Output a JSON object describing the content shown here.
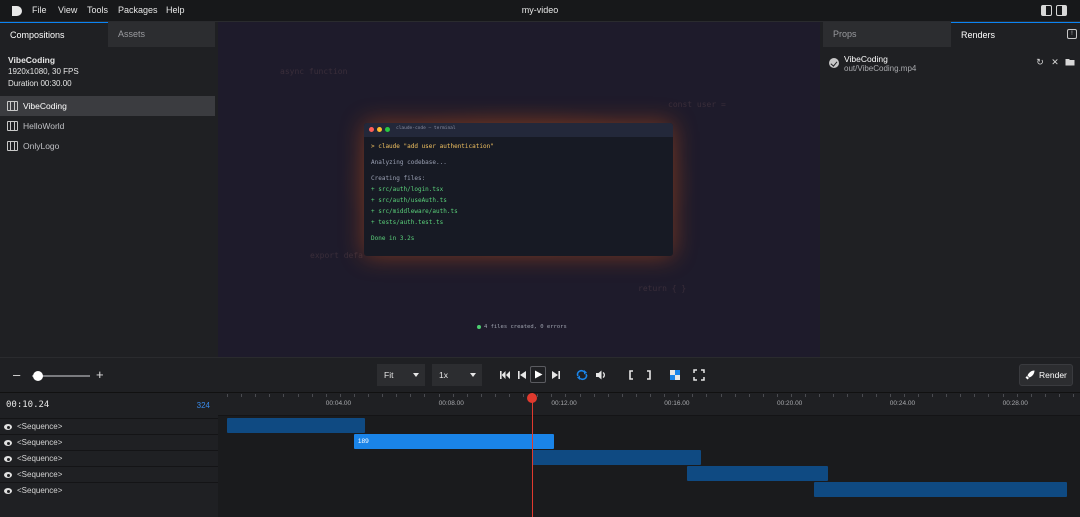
{
  "menubar": {
    "items": [
      "File",
      "View",
      "Tools",
      "Packages",
      "Help"
    ],
    "title": "my-video"
  },
  "left_panel": {
    "tabs": [
      "Compositions",
      "Assets"
    ],
    "selected_comp": {
      "name": "VibeCoding",
      "resolution": "1920x1080, 30 FPS",
      "duration": "Duration 00:30.00"
    },
    "compositions": [
      "VibeCoding",
      "HelloWorld",
      "OnlyLogo"
    ]
  },
  "preview": {
    "bg_code": [
      "async function",
      "const user =",
      "export defa",
      "return { }"
    ],
    "terminal": {
      "title": "claude-code — terminal",
      "command": "> claude \"add user authentication\"",
      "analyzing": "Analyzing codebase...",
      "creating": "Creating files:",
      "files": [
        "+ src/auth/login.tsx",
        "+ src/auth/useAuth.ts",
        "+ src/middleware/auth.ts",
        "+ tests/auth.test.ts"
      ],
      "done": "Done in 3.2s"
    },
    "status": "4 files created, 0 errors"
  },
  "right_panel": {
    "tabs": [
      "Props",
      "Renders"
    ],
    "info_badge": "!",
    "render": {
      "name": "VibeCoding",
      "path": "out/VibeCoding.mp4"
    }
  },
  "controls": {
    "zoom_level": 0.1,
    "fit_label": "Fit",
    "speed_label": "1x",
    "render_label": "Render"
  },
  "timeline": {
    "timecode": "00:10.24",
    "frame": "324",
    "ticks": [
      "00:04.00",
      "00:08.00",
      "00:12.00",
      "00:16.00",
      "00:20.00",
      "00:24.00",
      "00:28.00"
    ],
    "tracks": [
      {
        "label": "<Sequence>",
        "start_s": 0.0,
        "end_s": 4.9,
        "badge": ""
      },
      {
        "label": "<Sequence>",
        "start_s": 4.5,
        "end_s": 11.6,
        "badge": "189"
      },
      {
        "label": "<Sequence>",
        "start_s": 10.8,
        "end_s": 16.8,
        "badge": ""
      },
      {
        "label": "<Sequence>",
        "start_s": 16.3,
        "end_s": 21.3,
        "badge": ""
      },
      {
        "label": "<Sequence>",
        "start_s": 20.8,
        "end_s": 29.8,
        "badge": ""
      }
    ],
    "playhead_s": 10.8,
    "colors": {
      "sequence": "#0f4a82",
      "sequence_active": "#1a84e8",
      "playhead": "#e03a2e",
      "accent": "#0b84f3"
    }
  }
}
